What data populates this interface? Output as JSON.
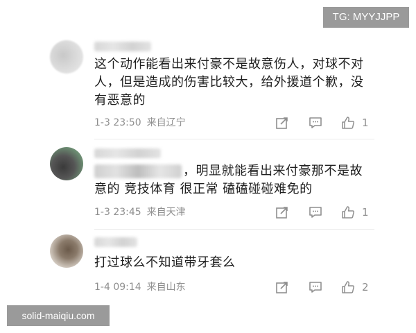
{
  "watermarks": {
    "top_right": "TG: MYYJJPP",
    "bottom_left": "solid-maiqiu.com"
  },
  "icons": {
    "share": "share-icon",
    "comment": "comment-icon",
    "like": "thumbs-up-icon"
  },
  "comments": [
    {
      "text": "这个动作能看出来付豪不是故意伤人，对球不对人，但是造成的伤害比较大，给外援道个歉，没有恶意的",
      "time": "1-3 23:50",
      "location": "来自辽宁",
      "likes": "1"
    },
    {
      "text": "，明显就能看出来付豪那不是故意的 竞技体育 很正常 磕磕碰碰难免的",
      "time": "1-3 23:45",
      "location": "来自天津",
      "likes": "1"
    },
    {
      "text": "打过球么不知道带牙套么",
      "time": "1-4 09:14",
      "location": "来自山东",
      "likes": "2"
    }
  ]
}
